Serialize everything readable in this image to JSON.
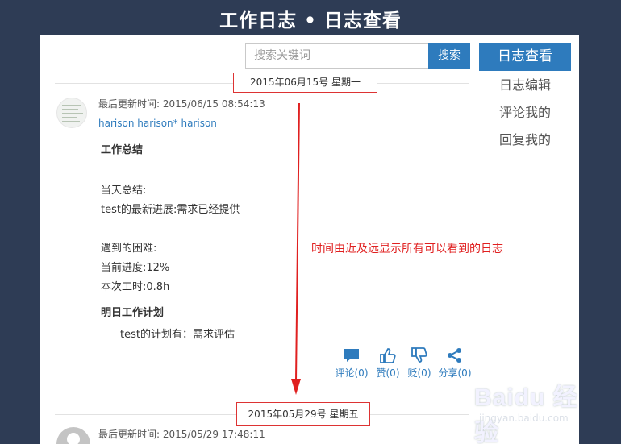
{
  "header": {
    "title": "工作日志 • 日志查看"
  },
  "search": {
    "placeholder": "搜索关键词",
    "button_label": "搜索"
  },
  "nav": {
    "active": "日志查看",
    "items": [
      "日志编辑",
      "评论我的",
      "回复我的"
    ]
  },
  "entries": [
    {
      "date_label": "2015年06月15号 星期一",
      "updated": "最后更新时间: 2015/06/15 08:54:13",
      "author": "harison  harison* harison",
      "section_summary_title": "工作总结",
      "summary_label": "当天总结:",
      "summary_line": "test的最新进展:需求已经提供",
      "issues_label": "遇到的困难:",
      "progress": "当前进度:12%",
      "hours": "本次工时:0.8h",
      "plan_title": "明日工作计划",
      "plan_line": "test的计划有：需求评估",
      "actions": {
        "comment": "评论(0)",
        "like": "赞(0)",
        "dislike": "贬(0)",
        "share": "分享(0)"
      }
    },
    {
      "date_label": "2015年05月29号 星期五",
      "updated": "最后更新时间: 2015/05/29 17:48:11"
    }
  ],
  "annotation": {
    "text": "时间由近及远显示所有可以看到的日志",
    "color": "#e02020"
  },
  "watermark": {
    "main": "Baidu 经验",
    "sub": "jingyan.baidu.com"
  },
  "colors": {
    "accent": "#2e7bbd",
    "background": "#2e3c55",
    "annotation": "#e02020"
  }
}
